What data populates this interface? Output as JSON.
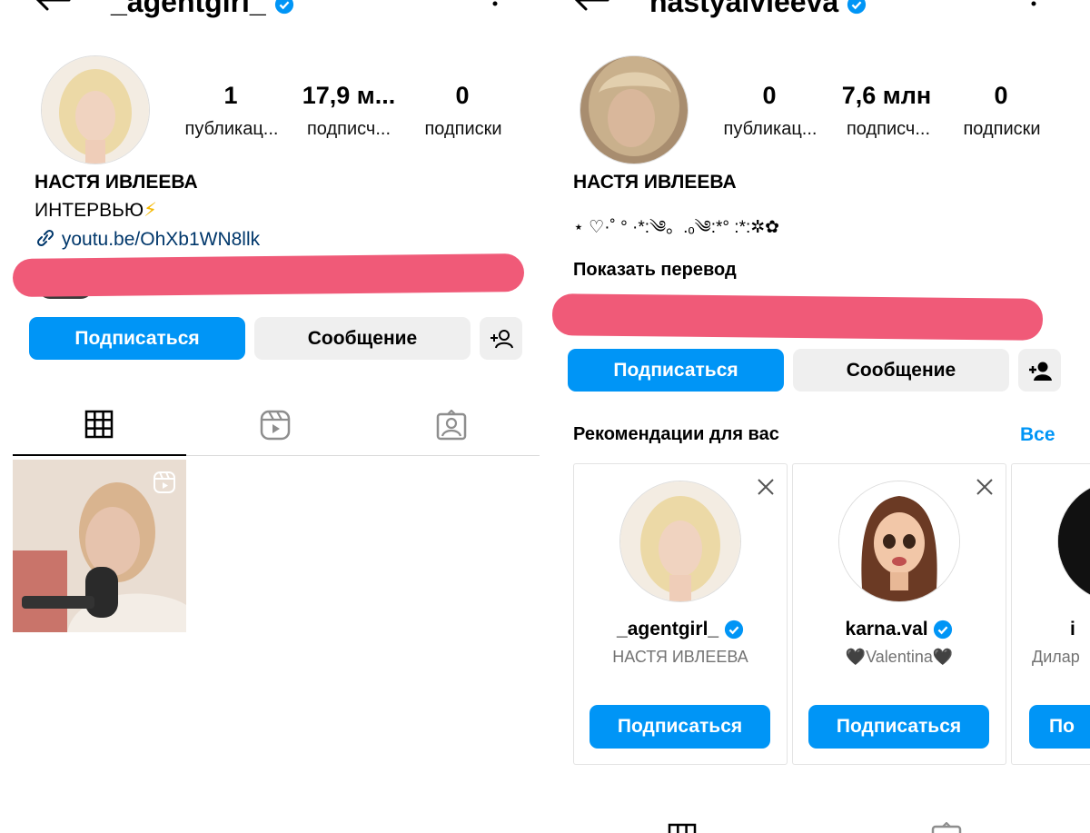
{
  "left_profile": {
    "username": "_agentgirl_",
    "stats": [
      {
        "value": "1",
        "label": "публикац..."
      },
      {
        "value": "17,9 м...",
        "label": "подписч..."
      },
      {
        "value": "0",
        "label": "подписки"
      }
    ],
    "name": "НАСТЯ ИВЛЕЕВА",
    "bio": "ИНТЕРВЬЮ",
    "bio_emoji": "⚡",
    "link": "youtu.be/OhXb1WN8llk",
    "follow_label": "Подписаться",
    "message_label": "Сообщение"
  },
  "right_profile": {
    "username": "nastyaivleeva",
    "stats": [
      {
        "value": "0",
        "label": "публикац..."
      },
      {
        "value": "7,6 млн",
        "label": "подписч..."
      },
      {
        "value": "0",
        "label": "подписки"
      }
    ],
    "name": "НАСТЯ ИВЛЕЕВА",
    "bio": "⋆ ♡·˚ ° ·*:༄。.ₒ༄:*° :*:✲✿",
    "show_translation": "Показать перевод",
    "follow_label": "Подписаться",
    "message_label": "Сообщение",
    "recommendations": {
      "title": "Рекомендации для вас",
      "see_all": "Все",
      "cards": [
        {
          "username": "_agentgirl_",
          "subtitle": "НАСТЯ ИВЛЕЕВА",
          "button": "Подписаться"
        },
        {
          "username": "karna.val",
          "subtitle": "🖤Valentina🖤",
          "button": "Подписаться"
        },
        {
          "username": "i",
          "subtitle": "Дилар",
          "button": "По"
        }
      ]
    }
  },
  "colors": {
    "primary_button": "#0095f6",
    "secondary_button": "#efefef",
    "verified_badge": "#0095f6",
    "link": "#00376b",
    "redaction": "#f05a78"
  }
}
